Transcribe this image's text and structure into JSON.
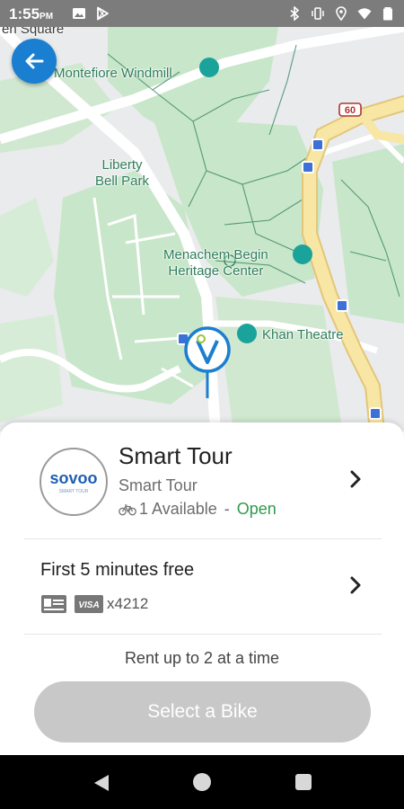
{
  "status_bar": {
    "time": "1:55",
    "ampm": "PM",
    "left_icons": [
      "image-icon",
      "play-store-icon"
    ],
    "right_icons": [
      "bluetooth-icon",
      "vibrate-icon",
      "location-icon",
      "wifi-icon",
      "battery-icon"
    ]
  },
  "map": {
    "labels": {
      "top_cut": "en Square",
      "windmill": "Montefiore Windmill",
      "park": "Liberty\nBell Park",
      "heritage": "Menachem Begin\nHeritage Center",
      "theatre": "Khan Theatre",
      "road_number": "60"
    },
    "colors": {
      "park": "#c8e6c9",
      "road": "#ffffff",
      "highway": "#f6df92",
      "accent": "#1a7fd1"
    }
  },
  "station": {
    "logo_text": "sovoo",
    "logo_subtext": "SMART TOUR",
    "title": "Smart Tour",
    "subtitle": "Smart Tour",
    "available_count": "1 Available",
    "separator": " - ",
    "status": "Open"
  },
  "pricing": {
    "title": "First 5 minutes free",
    "card_brand": "VISA",
    "card_number": "x4212"
  },
  "rent_limit": "Rent up to 2 at a time",
  "select_button": "Select a Bike"
}
